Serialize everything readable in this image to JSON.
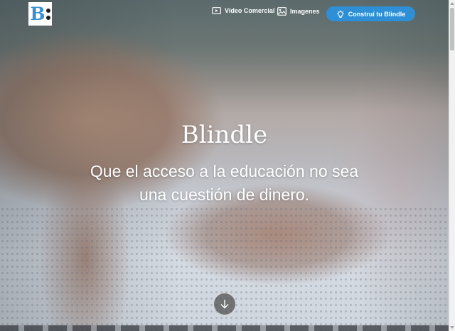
{
  "header": {
    "logo_letter": "B",
    "nav": [
      {
        "label": "Video Comercial",
        "icon": "play-icon"
      },
      {
        "label": "Imagenes",
        "icon": "image-icon"
      }
    ],
    "cta": {
      "label": "Construí tu Blindle",
      "icon": "lightbulb-icon"
    }
  },
  "hero": {
    "title": "Blindle",
    "subtitle": "Que el acceso a la educación no sea una cuestión de dinero.",
    "scroll_icon": "arrow-down-icon"
  },
  "colors": {
    "brand_blue": "#2f8fd6",
    "logo_blue": "#3b8fd0",
    "text": "#ffffff"
  }
}
